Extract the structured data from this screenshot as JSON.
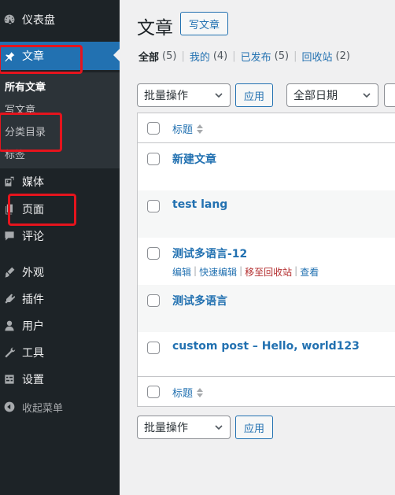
{
  "sidebar": {
    "items": [
      {
        "label": "仪表盘",
        "icon": "dashboard-icon"
      },
      {
        "label": "文章",
        "icon": "pin-icon"
      },
      {
        "label": "媒体",
        "icon": "media-icon"
      },
      {
        "label": "页面",
        "icon": "pages-icon"
      },
      {
        "label": "评论",
        "icon": "comments-icon"
      },
      {
        "label": "外观",
        "icon": "appearance-icon"
      },
      {
        "label": "插件",
        "icon": "plugins-icon"
      },
      {
        "label": "用户",
        "icon": "users-icon"
      },
      {
        "label": "工具",
        "icon": "tools-icon"
      },
      {
        "label": "设置",
        "icon": "settings-icon"
      }
    ],
    "submenu": [
      "所有文章",
      "写文章",
      "分类目录",
      "标签"
    ],
    "collapse_label": "收起菜单"
  },
  "header": {
    "title": "文章",
    "add_new_label": "写文章"
  },
  "filters": {
    "all_label": "全部",
    "all_count": "(5)",
    "mine_label": "我的",
    "mine_count": "(4)",
    "published_label": "已发布",
    "published_count": "(5)",
    "trash_label": "回收站",
    "trash_count": "(2)",
    "separator": "|"
  },
  "toolbar": {
    "bulk_actions": "批量操作",
    "apply_label": "应用",
    "all_dates": "全部日期"
  },
  "table": {
    "column_title": "标题",
    "rows": [
      {
        "title": "新建文章"
      },
      {
        "title": "test lang"
      },
      {
        "title": "测试多语言-12"
      },
      {
        "title": "测试多语言"
      },
      {
        "title": "custom post – Hello, world123"
      }
    ],
    "row_actions": {
      "edit": "编辑",
      "quick_edit": "快速编辑",
      "trash": "移至回收站",
      "view": "查看",
      "separator": "|"
    }
  },
  "colors": {
    "sidebar_bg": "#1d2327",
    "accent": "#2271b1",
    "highlight_box": "#e5141d",
    "trash_link": "#b32d2e"
  }
}
